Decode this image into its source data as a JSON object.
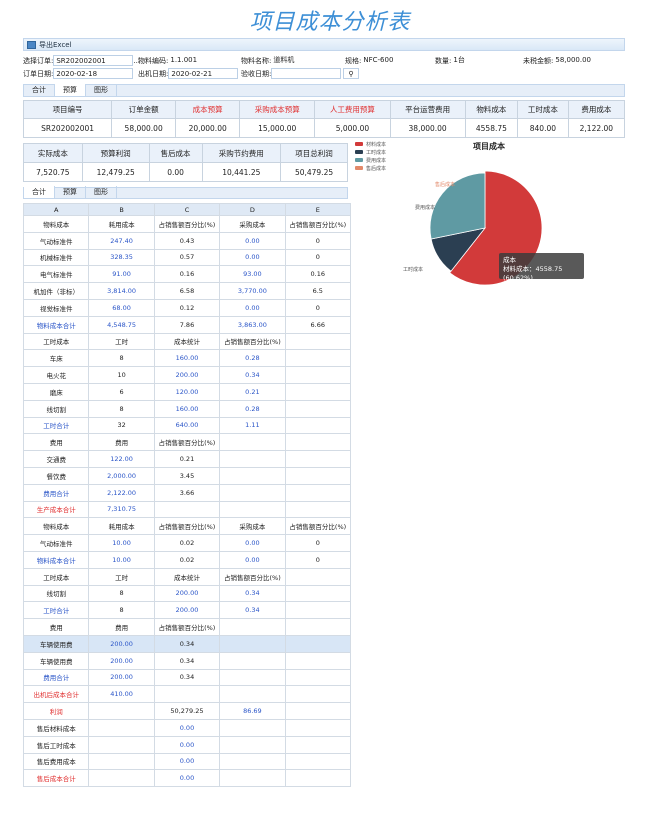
{
  "page_title": "项目成本分析表",
  "toolbar": {
    "export_label": "导出Excel"
  },
  "form": {
    "order_label": "选择订单:",
    "order_value": "SR202002001",
    "picker": "...",
    "material_code_label": "物料编码:",
    "material_code_value": "1.1.001",
    "material_name_label": "物料名称:",
    "material_name_value": "道料机",
    "spec_label": "规格:",
    "spec_value": "NFC-600",
    "qty_label": "数量:",
    "qty_value": "1台",
    "untaxed_label": "未税金额:",
    "untaxed_value": "58,000.00",
    "order_date_label": "订单日期:",
    "order_date_value": "2020-02-18",
    "ship_date_label": "出机日期:",
    "ship_date_value": "2020-02-21",
    "accept_date_label": "验收日期:",
    "accept_date_value": ""
  },
  "tabs": {
    "t1": "合计",
    "t2": "预算",
    "t3": "图形"
  },
  "summary": {
    "h": [
      "项目编号",
      "订单金额",
      "成本预算",
      "采购成本预算",
      "人工费用预算",
      "平台运营费用",
      "物料成本",
      "工时成本",
      "费用成本"
    ],
    "v": [
      "SR202002001",
      "58,000.00",
      "20,000.00",
      "15,000.00",
      "5,000.00",
      "38,000.00",
      "4558.75",
      "840.00",
      "2,122.00"
    ]
  },
  "summary2": {
    "h": [
      "实际成本",
      "预算利润",
      "售后成本",
      "采购节约费用",
      "项目总利润"
    ],
    "v": [
      "7,520.75",
      "12,479.25",
      "0.00",
      "10,441.25",
      "50,479.25"
    ]
  },
  "sheet_cols": [
    "A",
    "B",
    "C",
    "D",
    "E"
  ],
  "sheet_rows": [
    [
      "物料成本",
      "耗用成本",
      "占销售额百分比(%)",
      "采购成本",
      "占销售额百分比(%)"
    ],
    [
      "气动标准件",
      "247.40",
      "0.43",
      "0.00",
      "0"
    ],
    [
      "机械标准件",
      "328.35",
      "0.57",
      "0.00",
      "0"
    ],
    [
      "电气标准件",
      "91.00",
      "0.16",
      "93.00",
      "0.16"
    ],
    [
      "机加件（非标）",
      "3,814.00",
      "6.58",
      "3,770.00",
      "6.5"
    ],
    [
      "视觉标准件",
      "68.00",
      "0.12",
      "0.00",
      "0"
    ],
    [
      "物料成本合计",
      "4,548.75",
      "7.86",
      "3,863.00",
      "6.66"
    ],
    [
      "工时成本",
      "工时",
      "成本统计",
      "占销售额百分比(%)",
      ""
    ],
    [
      "车床",
      "8",
      "160.00",
      "0.28",
      ""
    ],
    [
      "电火花",
      "10",
      "200.00",
      "0.34",
      ""
    ],
    [
      "磨床",
      "6",
      "120.00",
      "0.21",
      ""
    ],
    [
      "线切割",
      "8",
      "160.00",
      "0.28",
      ""
    ],
    [
      "工时合计",
      "32",
      "640.00",
      "1.11",
      ""
    ],
    [
      "费用",
      "费用",
      "占销售额百分比(%)",
      "",
      ""
    ],
    [
      "交通费",
      "122.00",
      "0.21",
      "",
      ""
    ],
    [
      "餐饮费",
      "2,000.00",
      "3.45",
      "",
      ""
    ],
    [
      "费用合计",
      "2,122.00",
      "3.66",
      "",
      ""
    ],
    [
      "生产成本合计",
      "7,310.75",
      "",
      "",
      ""
    ],
    [
      "物料成本",
      "耗用成本",
      "占销售额百分比(%)",
      "采购成本",
      "占销售额百分比(%)"
    ],
    [
      "气动标准件",
      "10.00",
      "0.02",
      "0.00",
      "0"
    ],
    [
      "物料成本合计",
      "10.00",
      "0.02",
      "0.00",
      "0"
    ],
    [
      "工时成本",
      "工时",
      "成本统计",
      "占销售额百分比(%)",
      ""
    ],
    [
      "线切割",
      "8",
      "200.00",
      "0.34",
      ""
    ],
    [
      "工时合计",
      "8",
      "200.00",
      "0.34",
      ""
    ],
    [
      "费用",
      "费用",
      "占销售额百分比(%)",
      "",
      ""
    ],
    [
      "车辆使用费",
      "200.00",
      "0.34",
      "",
      ""
    ],
    [
      "车辆使用费",
      "200.00",
      "0.34",
      "",
      ""
    ],
    [
      "费用合计",
      "200.00",
      "0.34",
      "",
      ""
    ],
    [
      "出机后成本合计",
      "410.00",
      "",
      "",
      ""
    ],
    [
      "利润",
      "",
      "50,279.25",
      "86.69",
      ""
    ],
    [
      "售后材料成本",
      "",
      "0.00",
      "",
      ""
    ],
    [
      "售后工时成本",
      "",
      "0.00",
      "",
      ""
    ],
    [
      "售后费用成本",
      "",
      "0.00",
      "",
      ""
    ],
    [
      "售后成本合计",
      "",
      "0.00",
      "",
      ""
    ]
  ],
  "chart_data": {
    "type": "pie",
    "title": "项目成本",
    "labels": [
      "材料成本",
      "工时成本",
      "费用成本",
      "售后成本"
    ],
    "values": [
      4558.75,
      840,
      2122,
      0
    ],
    "colors": [
      "#d23a3a",
      "#2b3f52",
      "#5f9aa3",
      "#e2896a"
    ],
    "tooltip": {
      "line1": "成本",
      "line2": "材料成本：4558.75 (60.62%)"
    }
  }
}
